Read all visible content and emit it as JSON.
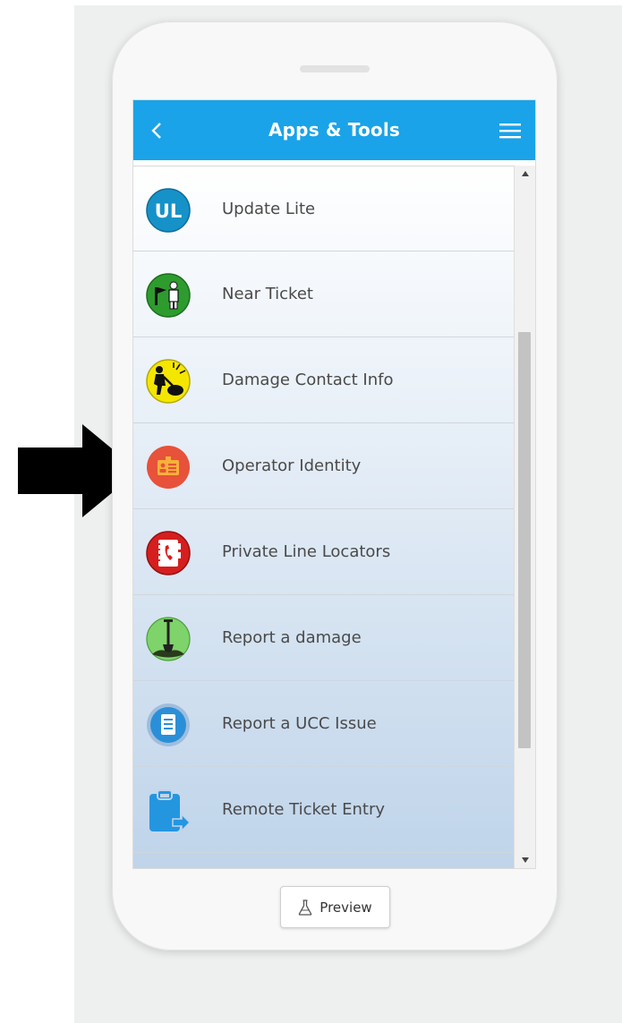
{
  "header": {
    "title": "Apps & Tools",
    "back_icon": "chevron-left-icon",
    "menu_icon": "hamburger-menu-icon",
    "color": "#1aa3e8"
  },
  "items": [
    {
      "label": "Update Lite",
      "icon": "update-lite-icon"
    },
    {
      "label": "Near Ticket",
      "icon": "near-ticket-icon"
    },
    {
      "label": "Damage Contact Info",
      "icon": "damage-contact-icon"
    },
    {
      "label": "Operator Identity",
      "icon": "operator-identity-icon"
    },
    {
      "label": "Private Line Locators",
      "icon": "phone-book-icon"
    },
    {
      "label": "Report a damage",
      "icon": "shovel-icon"
    },
    {
      "label": "Report a UCC Issue",
      "icon": "document-icon"
    },
    {
      "label": "Remote Ticket Entry",
      "icon": "clipboard-export-icon"
    }
  ],
  "update_lite_badge": "UL",
  "preview": {
    "label": "Preview",
    "icon": "flask-icon"
  },
  "annotation": {
    "icon": "arrow-right-icon",
    "color": "#000000"
  }
}
